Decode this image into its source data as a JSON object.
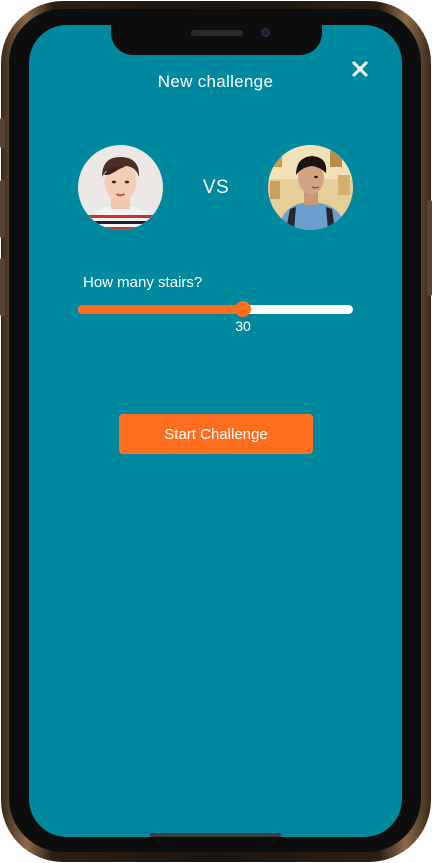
{
  "header": {
    "title": "New challenge",
    "close_icon": "close-icon"
  },
  "matchup": {
    "vs_label": "VS",
    "player_left": {
      "avatar": "avatar-photo"
    },
    "player_right": {
      "avatar": "avatar-photo"
    }
  },
  "stairs": {
    "label": "How many stairs?",
    "value": "30",
    "fill_fraction": 0.6
  },
  "actions": {
    "start_label": "Start Challenge"
  },
  "colors": {
    "background": "#00889e",
    "accent": "#ff6e1f",
    "text": "#ffffff"
  }
}
